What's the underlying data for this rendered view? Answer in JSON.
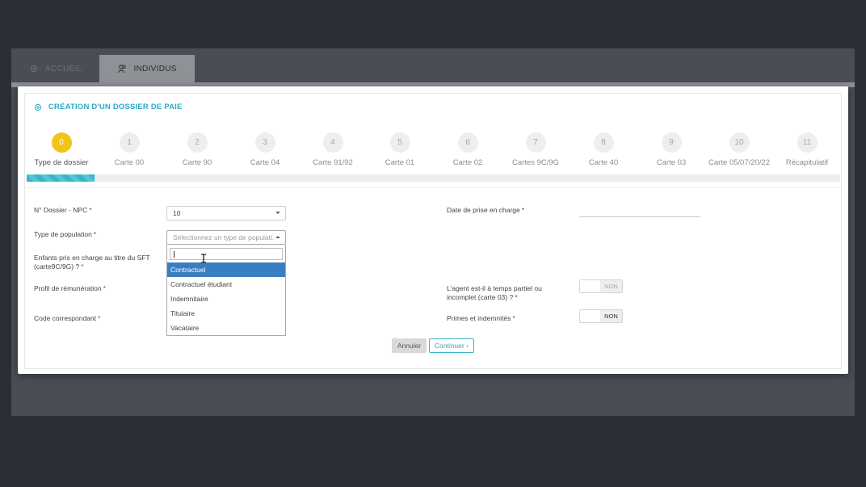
{
  "background_tabs": [
    {
      "label": "ACCUEIL",
      "icon": "settings-icon",
      "active": false
    },
    {
      "label": "INDIVIDUS",
      "icon": "users-icon",
      "active": true
    }
  ],
  "modal": {
    "title": "CRÉATION D'UN DOSSIER DE PAIE",
    "title_icon": "gear-icon"
  },
  "stepper": {
    "active_index": 0,
    "progress_fraction": 0.083,
    "steps": [
      {
        "number": "0",
        "label": "Type de dossier"
      },
      {
        "number": "1",
        "label": "Carte 00"
      },
      {
        "number": "2",
        "label": "Carte 90"
      },
      {
        "number": "3",
        "label": "Carte 04"
      },
      {
        "number": "4",
        "label": "Carte 91/92"
      },
      {
        "number": "5",
        "label": "Carte 01"
      },
      {
        "number": "6",
        "label": "Carte 02"
      },
      {
        "number": "7",
        "label": "Cartes 9C/9G"
      },
      {
        "number": "8",
        "label": "Carte 40"
      },
      {
        "number": "9",
        "label": "Carte 03"
      },
      {
        "number": "10",
        "label": "Carte 05/07/20/22"
      },
      {
        "number": "11",
        "label": "Récapitulatif"
      }
    ]
  },
  "form": {
    "dossier_npc": {
      "label": "N° Dossier - NPC",
      "value": "10"
    },
    "type_population": {
      "label": "Type de population",
      "placeholder": "Sélectionnez un type de populati...",
      "search_value": "",
      "options": [
        "Contractuel",
        "Contractuel étudiant",
        "Indemnitaire",
        "Titulaire",
        "Vacataire"
      ],
      "highlighted": "Contractuel"
    },
    "enfants_sft": {
      "label_line1": "Enfants pris en charge au titre du SFT",
      "label_line2": "(carte9C/9G) ?"
    },
    "profil_remuneration": {
      "label": "Profil de rémunération"
    },
    "code_correspondant": {
      "label": "Code correspondant"
    },
    "date_prise_en_charge": {
      "label": "Date de prise en charge",
      "value": ""
    },
    "temps_partiel": {
      "label_line1": "L'agent est-il à temps partiel ou",
      "label_line2": "incomplet (carte 03) ?",
      "value": "NON"
    },
    "primes_indemnites": {
      "label": "Primes et indemnités",
      "value": "NON"
    },
    "required_marker": "*"
  },
  "actions": {
    "cancel": "Annuler",
    "continue": "Continuer ›"
  },
  "colors": {
    "accent": "#2fa7c2",
    "active_step": "#f0c419",
    "selected_option": "#3a7ec2",
    "required": "#c0392b"
  }
}
